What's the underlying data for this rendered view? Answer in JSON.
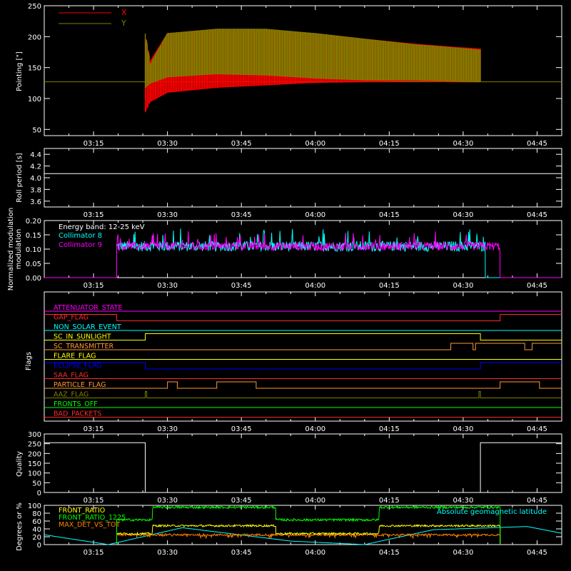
{
  "time_axis": {
    "tick_labels": [
      "03:15",
      "03:30",
      "03:45",
      "04:00",
      "04:15",
      "04:30",
      "04:45"
    ],
    "tick_minutes": [
      195,
      210,
      225,
      240,
      255,
      270,
      285
    ],
    "range_minutes": [
      185,
      290
    ]
  },
  "chart_data": [
    {
      "type": "area",
      "ylabel": "Pointing [\"]",
      "ylim": [
        40,
        250
      ],
      "yticks": [
        50,
        100,
        150,
        200,
        250
      ],
      "legend": {
        "placement": "top-left"
      },
      "baseline_value": 127,
      "series": [
        {
          "name": "X",
          "color": "#ff0000",
          "t_start": 205.5,
          "t_end": 273.5,
          "env_t": [
            205.5,
            206.5,
            210,
            220,
            230,
            240,
            250,
            260,
            268,
            273.5
          ],
          "upper": [
            205,
            160,
            205,
            212,
            210,
            205,
            196,
            188,
            183,
            180
          ],
          "lower": [
            78,
            95,
            110,
            118,
            122,
            126,
            127,
            128,
            127,
            127
          ]
        },
        {
          "name": "Y",
          "color": "#808000",
          "t_start": 205.5,
          "t_end": 273.5,
          "env_t": [
            205.5,
            206.5,
            210,
            220,
            230,
            240,
            250,
            260,
            268,
            273.5
          ],
          "upper": [
            205,
            155,
            205,
            212,
            212,
            205,
            196,
            187,
            182,
            178
          ],
          "lower": [
            118,
            125,
            135,
            140,
            138,
            133,
            130,
            130,
            128,
            127
          ]
        }
      ]
    },
    {
      "type": "line",
      "ylabel": "Roll period [s]",
      "ylim": [
        3.5,
        4.5
      ],
      "yticks": [
        3.6,
        3.8,
        4.0,
        4.2,
        4.4
      ],
      "series": [
        {
          "name": "",
          "color": "#ffffff",
          "t": [
            185,
            290
          ],
          "values": [
            4.07,
            4.07
          ]
        }
      ]
    },
    {
      "type": "line",
      "ylabel": "Normalized modulation",
      "ylim": [
        0,
        0.2
      ],
      "yticks": [
        0.0,
        0.05,
        0.1,
        0.15,
        0.2
      ],
      "ytick_labels": [
        "0.00",
        "0.05",
        "0.10",
        "0.15",
        "0.20"
      ],
      "annotation": "Energy band: 12-25 keV",
      "series": [
        {
          "name": "Collimator 8",
          "color": "#00ffff",
          "t_start": 199.7,
          "t_end": 274.5,
          "mean": 0.11,
          "spread": 0.018
        },
        {
          "name": "Collimator 9",
          "color": "#ff00ff",
          "t_start": 199.7,
          "t_end": 277.5,
          "mean": 0.11,
          "spread": 0.015
        }
      ]
    },
    {
      "type": "line",
      "ylabel": "Flags",
      "flags": [
        {
          "name": "ATTENUATOR_STATE",
          "color": "#ff00ff",
          "segments": [
            [
              185,
              290,
              0
            ]
          ]
        },
        {
          "name": "GAP_FLAG",
          "color": "#ff2a2a",
          "segments": [
            [
              185,
              199.7,
              1
            ],
            [
              199.7,
              277.5,
              0
            ],
            [
              277.5,
              290,
              1
            ]
          ]
        },
        {
          "name": "NON_SOLAR_EVENT",
          "color": "#00ffff",
          "segments": [
            [
              185,
              290,
              0
            ]
          ]
        },
        {
          "name": "SC_IN_SUNLIGHT",
          "color": "#ffff00",
          "segments": [
            [
              185,
              205.5,
              0
            ],
            [
              205.5,
              273.5,
              1
            ],
            [
              273.5,
              290,
              0
            ]
          ]
        },
        {
          "name": "SC_TRANSMITTER",
          "color": "#ff9933",
          "segments": [
            [
              185,
              267.5,
              0
            ],
            [
              267.5,
              272,
              1
            ],
            [
              272,
              272.5,
              0
            ],
            [
              272.5,
              282.5,
              1
            ],
            [
              282.5,
              284,
              0
            ],
            [
              284,
              293,
              1
            ],
            [
              293,
              290,
              0
            ]
          ]
        },
        {
          "name": "FLARE_FLAG",
          "color": "#ffff00",
          "segments": [
            [
              185,
              290,
              0
            ]
          ]
        },
        {
          "name": "ECLIPSE_FLAG",
          "color": "#0000ff",
          "segments": [
            [
              185,
              205.5,
              1
            ],
            [
              205.5,
              273.5,
              0
            ],
            [
              273.5,
              290,
              1
            ]
          ]
        },
        {
          "name": "SAA_FLAG",
          "color": "#ff2a2a",
          "segments": [
            [
              185,
              290,
              0
            ]
          ]
        },
        {
          "name": "PARTICLE_FLAG",
          "color": "#ff9933",
          "segments": [
            [
              185,
              210,
              0
            ],
            [
              210,
              212,
              1
            ],
            [
              212,
              220,
              0
            ],
            [
              220,
              228,
              1
            ],
            [
              228,
              277.5,
              0
            ],
            [
              277.5,
              285.5,
              1
            ],
            [
              285.5,
              290,
              0
            ]
          ]
        },
        {
          "name": "AAZ_FLAG",
          "color": "#808000",
          "segments": [
            [
              185,
              205.5,
              0
            ],
            [
              205.5,
              205.8,
              1
            ],
            [
              205.8,
              273.2,
              0
            ],
            [
              273.2,
              273.5,
              1
            ],
            [
              273.5,
              290,
              0
            ]
          ]
        },
        {
          "name": "FRONTS_OFF",
          "color": "#00ff00",
          "segments": [
            [
              185,
              290,
              0
            ]
          ]
        },
        {
          "name": "BAD_PACKETS",
          "color": "#ff2a2a",
          "segments": [
            [
              185,
              290,
              0
            ]
          ]
        }
      ]
    },
    {
      "type": "line",
      "ylabel": "Quality",
      "ylim": [
        0,
        300
      ],
      "yticks": [
        0,
        50,
        100,
        150,
        200,
        250,
        300
      ],
      "series": [
        {
          "name": "",
          "color": "#ffffff",
          "t": [
            185,
            205.5,
            205.5,
            273.5,
            273.5,
            290
          ],
          "values": [
            255,
            255,
            0,
            0,
            255,
            255
          ]
        }
      ]
    },
    {
      "type": "line",
      "ylabel": "Degrees or %",
      "ylim": [
        0,
        100
      ],
      "yticks": [
        0,
        20,
        40,
        60,
        80,
        100
      ],
      "series": [
        {
          "name": "FRONT_RATIO",
          "color": "#ffff00",
          "levels": [
            [
              199.7,
              207,
              28
            ],
            [
              207,
              232,
              48
            ],
            [
              232,
              253,
              28
            ],
            [
              253,
              277.5,
              48
            ]
          ]
        },
        {
          "name": "FRONT_RATIO_1225",
          "color": "#00ff00",
          "levels": [
            [
              199.7,
              207,
              63
            ],
            [
              207,
              232,
              95
            ],
            [
              232,
              253,
              63
            ],
            [
              253,
              277.5,
              95
            ]
          ]
        },
        {
          "name": "MAX_DET_VS_TOT",
          "color": "#ff8000",
          "levels": [
            [
              199.7,
              277.5,
              25
            ]
          ]
        },
        {
          "name": "Absolute geomagnetic latitude",
          "color": "#00ffff",
          "t": [
            185,
            198,
            213,
            235,
            250,
            264,
            283,
            290
          ],
          "values": [
            25,
            0,
            43,
            9,
            0,
            38,
            46,
            29
          ]
        }
      ]
    }
  ]
}
